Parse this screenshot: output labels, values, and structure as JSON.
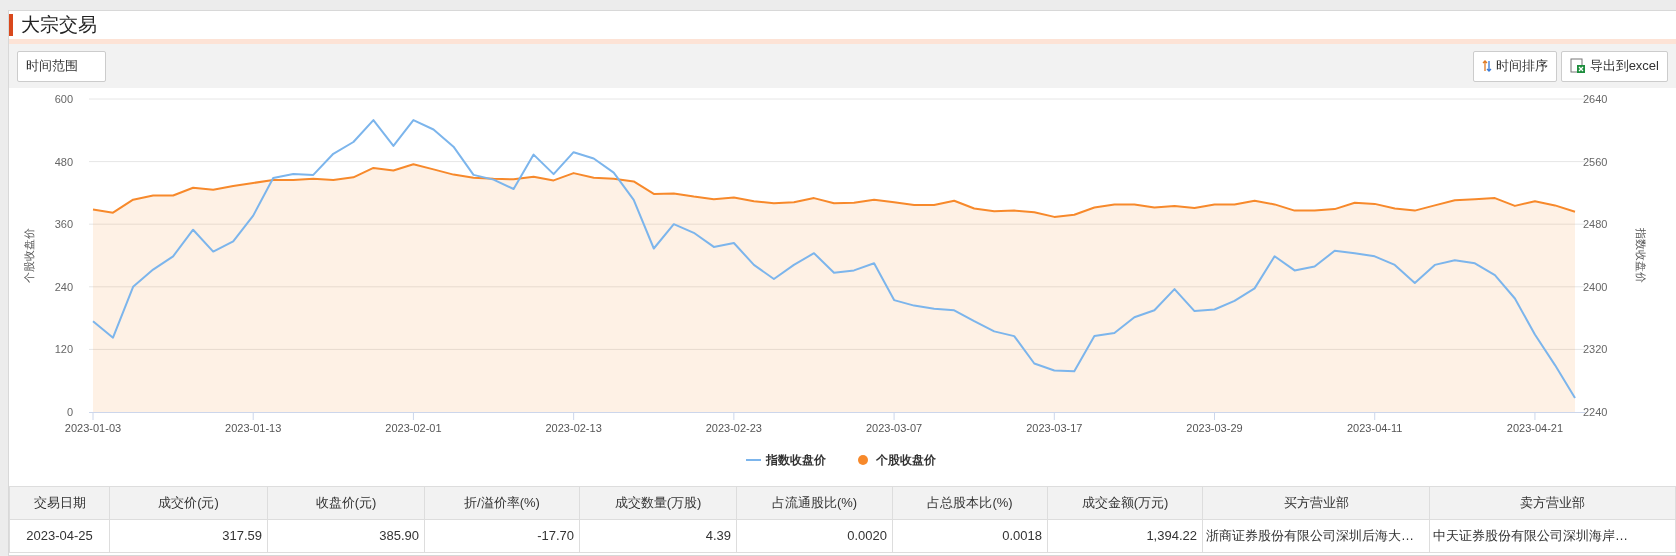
{
  "title": "大宗交易",
  "toolbar": {
    "filter_button": "时间范围",
    "sort_button": "时间排序",
    "export_button": "导出到excel"
  },
  "chart": {
    "chart_data": {
      "type": "line",
      "ylabel": "个股收盘价",
      "y2label": "指数收盘价",
      "categories": [
        "2023-01-03",
        null,
        null,
        null,
        null,
        null,
        null,
        null,
        "2023-01-13",
        null,
        null,
        null,
        null,
        null,
        null,
        null,
        "2023-02-01",
        null,
        null,
        null,
        null,
        null,
        null,
        null,
        "2023-02-13",
        null,
        null,
        null,
        null,
        null,
        null,
        null,
        "2023-02-23",
        null,
        null,
        null,
        null,
        null,
        null,
        null,
        "2023-03-07",
        null,
        null,
        null,
        null,
        null,
        null,
        null,
        "2023-03-17",
        null,
        null,
        null,
        null,
        null,
        null,
        null,
        "2023-03-29",
        null,
        null,
        null,
        null,
        null,
        null,
        null,
        "2023-04-11",
        null,
        null,
        null,
        null,
        null,
        null,
        null,
        "2023-04-21",
        null,
        null
      ],
      "grid": true,
      "legend": "bottom",
      "ylim": [
        0,
        600
      ],
      "yticks": [
        0,
        120,
        240,
        360,
        480,
        600
      ],
      "y2lim": [
        2240,
        2640
      ],
      "y2ticks": [
        2240,
        2320,
        2400,
        2480,
        2560,
        2640
      ],
      "series": [
        {
          "name": "指数收盘价",
          "color": "#7cb5ec",
          "axis": "y2",
          "type": "line",
          "values": [
            2356,
            2335,
            2400,
            2422,
            2439,
            2473,
            2445,
            2458,
            2491,
            2539,
            2544,
            2543,
            2570,
            2585,
            2613,
            2580,
            2613,
            2601,
            2579,
            2543,
            2537,
            2525,
            2569,
            2544,
            2572,
            2564,
            2546,
            2511,
            2449,
            2480,
            2469,
            2451,
            2456,
            2428,
            2410,
            2428,
            2443,
            2418,
            2421,
            2430,
            2383,
            2376,
            2372,
            2370,
            2356,
            2343,
            2337,
            2302,
            2293,
            2292,
            2337,
            2341,
            2361,
            2370,
            2397,
            2369,
            2371,
            2382,
            2398,
            2439,
            2421,
            2426,
            2446,
            2443,
            2439,
            2428,
            2405,
            2428,
            2434,
            2430,
            2415,
            2385,
            2339,
            2300,
            2258
          ]
        },
        {
          "name": "个股收盘价",
          "color": "#f7892b",
          "type": "area",
          "values": [
            388,
            382,
            407,
            415,
            415,
            430,
            426,
            433,
            439,
            445,
            445,
            447,
            445,
            450,
            468,
            463,
            475,
            465,
            455,
            449,
            447,
            446,
            451,
            444,
            458,
            449,
            447,
            442,
            418,
            419,
            413,
            408,
            411,
            404,
            400,
            402,
            410,
            400,
            401,
            407,
            402,
            397,
            397,
            405,
            390,
            385,
            386,
            383,
            374,
            378,
            392,
            398,
            398,
            392,
            395,
            391,
            398,
            398,
            405,
            398,
            386,
            386,
            389,
            401,
            399,
            390,
            386,
            396,
            406,
            408,
            410,
            395,
            404,
            396,
            384
          ]
        }
      ]
    }
  },
  "table": {
    "columns": [
      "交易日期",
      "成交价(元)",
      "收盘价(元)",
      "折/溢价率(%)",
      "成交数量(万股)",
      "占流通股比(%)",
      "占总股本比(%)",
      "成交金额(万元)",
      "买方营业部",
      "卖方营业部"
    ],
    "rows": [
      [
        "2023-04-25",
        "317.59",
        "385.90",
        "-17.70",
        "4.39",
        "0.0020",
        "0.0018",
        "1,394.22",
        "浙商证券股份有限公司深圳后海大…",
        "中天证券股份有限公司深圳海岸…"
      ]
    ]
  }
}
